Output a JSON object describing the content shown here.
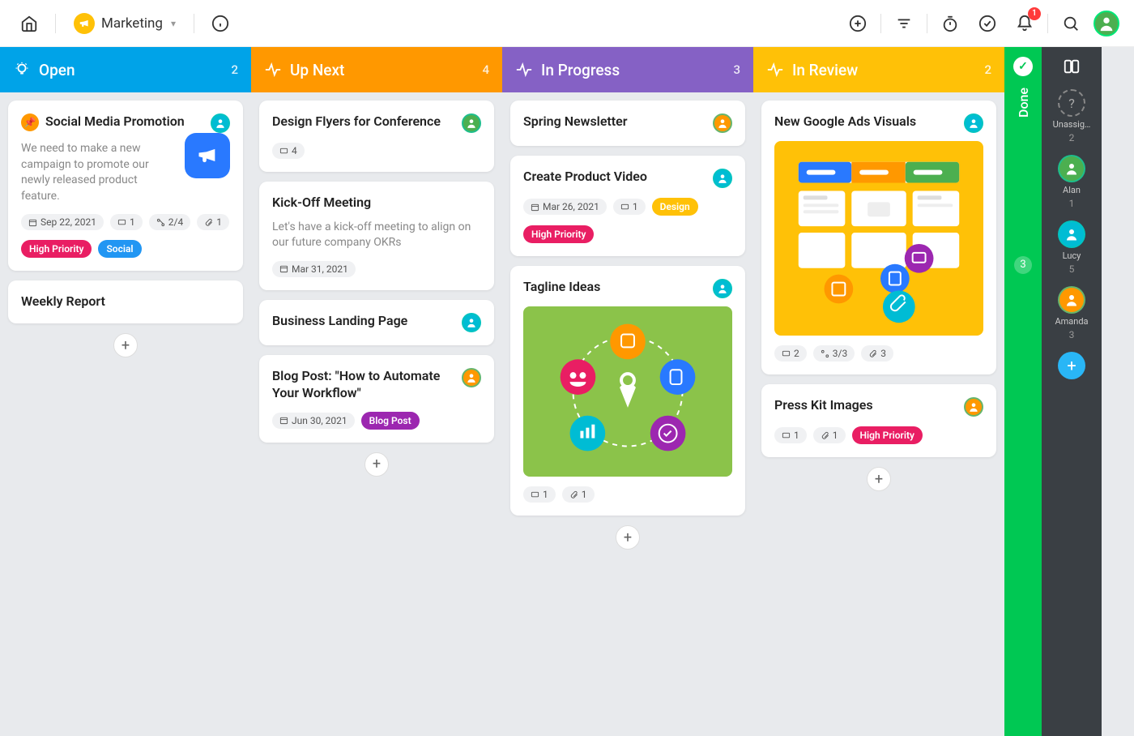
{
  "header": {
    "workspace": "Marketing",
    "notification_count": "1"
  },
  "columns": [
    {
      "id": "open",
      "title": "Open",
      "count": "2",
      "color": "#00a3e8"
    },
    {
      "id": "upnext",
      "title": "Up Next",
      "count": "4",
      "color": "#ff9800"
    },
    {
      "id": "inprogress",
      "title": "In Progress",
      "count": "3",
      "color": "#8561c5"
    },
    {
      "id": "inreview",
      "title": "In Review",
      "count": "2",
      "color": "#ffc107"
    }
  ],
  "done": {
    "label": "Done",
    "count": "3"
  },
  "rail": {
    "unassigned": {
      "label": "Unassig…",
      "count": "2"
    },
    "members": [
      {
        "name": "Alan",
        "count": "1",
        "bg": "#4caf50"
      },
      {
        "name": "Lucy",
        "count": "5",
        "bg": "#00bcd4"
      },
      {
        "name": "Amanda",
        "count": "3",
        "bg": "#ff9800"
      }
    ]
  },
  "cards": {
    "open": [
      {
        "pinned": true,
        "title": "Social Media Promotion",
        "desc": "We need to make a new campaign to promote our newly released product feature.",
        "date": "Sep 22, 2021",
        "comments": "1",
        "subtasks": "2/4",
        "attachments": "1",
        "tags": [
          {
            "label": "High Priority",
            "cls": "tag-red"
          },
          {
            "label": "Social",
            "cls": "tag-blue"
          }
        ],
        "hero": true,
        "assignee_bg": "#00bcd4"
      },
      {
        "title": "Weekly Report"
      }
    ],
    "upnext": [
      {
        "title": "Design Flyers for Conference",
        "comments": "4",
        "assignee_bg": "#4caf50"
      },
      {
        "title": "Kick-Off Meeting",
        "desc": "Let's have a kick-off meeting to align on our future company OKRs",
        "date": "Mar 31, 2021"
      },
      {
        "title": "Business Landing Page",
        "assignee_bg": "#00bcd4"
      },
      {
        "title": "Blog Post: \"How to Automate Your Workflow\"",
        "date": "Jun 30, 2021",
        "tags": [
          {
            "label": "Blog Post",
            "cls": "tag-purple"
          }
        ],
        "assignee_bg": "#ff9800"
      }
    ],
    "inprogress": [
      {
        "title": "Spring Newsletter",
        "assignee_bg": "#ff9800"
      },
      {
        "title": "Create Product Video",
        "date": "Mar 26, 2021",
        "comments": "1",
        "tags": [
          {
            "label": "Design",
            "cls": "tag-amber"
          }
        ],
        "extra_tags": [
          {
            "label": "High Priority",
            "cls": "tag-red"
          }
        ],
        "assignee_bg": "#00bcd4"
      },
      {
        "title": "Tagline Ideas",
        "image": "tagline",
        "comments": "1",
        "attachments": "1",
        "assignee_bg": "#00bcd4"
      }
    ],
    "inreview": [
      {
        "title": "New Google Ads Visuals",
        "image": "ads",
        "comments": "2",
        "subtasks": "3/3",
        "attachments": "3",
        "assignee_bg": "#00bcd4"
      },
      {
        "title": "Press Kit Images",
        "comments": "1",
        "attachments": "1",
        "tags": [
          {
            "label": "High Priority",
            "cls": "tag-red"
          }
        ],
        "assignee_bg": "#ff9800"
      }
    ]
  }
}
